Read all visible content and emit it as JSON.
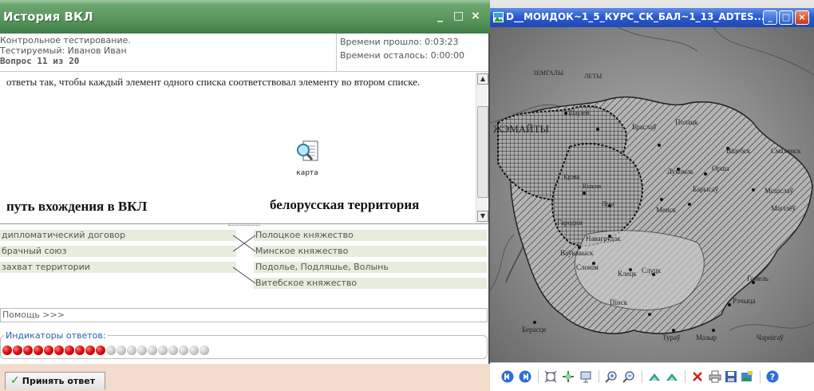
{
  "test_window": {
    "title": "История ВКЛ",
    "min": "_",
    "max": "□",
    "close": "×",
    "info": {
      "line1": "Контрольное тестирование.",
      "line2": "Тестируемый: Иванов Иван",
      "line3": "Вопрос  11  из  20",
      "elapsed": "Времени прошло:  0:03:23",
      "remaining": "Времени осталось:  0:00:00"
    },
    "question_text": "ответы так, чтобы каждый элемент одного списка соответствовал элементу во втором списке.",
    "map_link_label": "карта",
    "left_heading": "путь вхождения в ВКЛ",
    "right_heading": "белорусская территория",
    "left_items": [
      "дипломатический договор",
      "брачный союз",
      "захват территории"
    ],
    "right_items": [
      "Полоцкое княжество",
      "Минское княжество",
      "Подолье, Подляшье, Волынь",
      "Витебское княжество"
    ],
    "help": "Помощь >>>",
    "indicators_legend": "Индикаторы ответов:",
    "indicators": {
      "total": 20,
      "answered": 10
    },
    "accept_label": "Принять ответ",
    "accept_check": "✓",
    "scroll_up": "▲",
    "scroll_down": "▼"
  },
  "viewer_window": {
    "title": "D__МОИДОК~1_5_КУРС_СК_БАЛ~1_13_ADTES...",
    "min": "_",
    "max": "□",
    "close": "×",
    "map_labels": [
      "ЗЕМГАЛЫ",
      "ЛЕТЫ",
      "ЖЭМАЙТЫ",
      "Шаулей",
      "Браслаў",
      "Полацк",
      "Віцебск",
      "Смаленск",
      "Лукомль",
      "Орша",
      "Мсціслаў",
      "Магілёў",
      "Барысаў",
      "Менск",
      "Вільня",
      "Крэва",
      "Ліда",
      "Гародня",
      "Навагрудак",
      "Ваўкавыск",
      "Слонім",
      "Клецк",
      "Слуцк",
      "Гомель",
      "Рэчыца",
      "Пінск",
      "Тураў",
      "Мазыр",
      "Берасце",
      "Чарнігаў"
    ],
    "colors": {
      "titlebar": "#2a5bcf",
      "test_title": "#5e9a62"
    }
  }
}
